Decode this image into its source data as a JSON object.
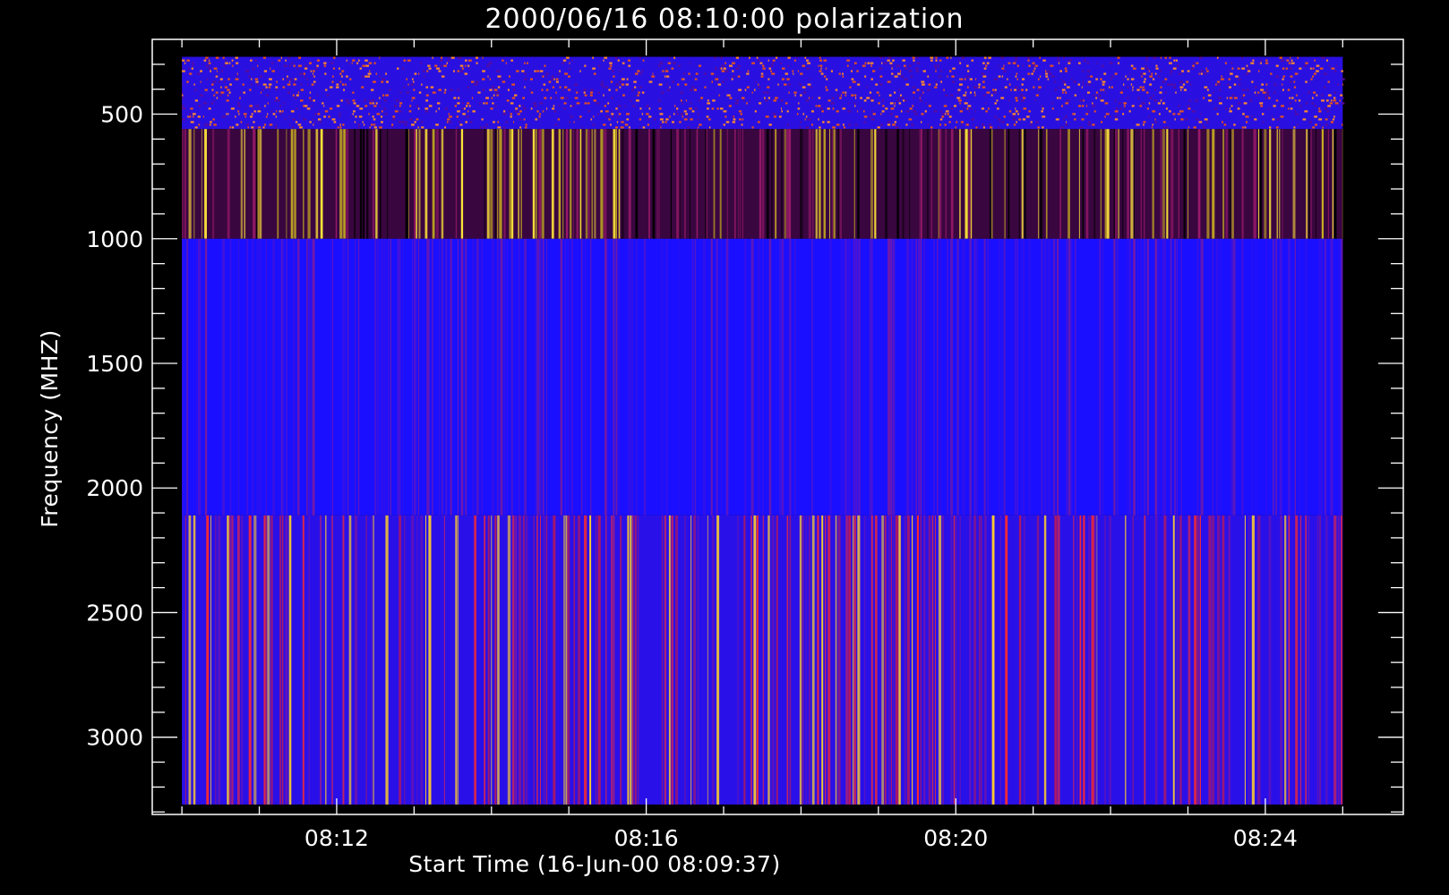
{
  "chart_data": {
    "type": "heatmap",
    "title": "2000/06/16 08:10:00 polarization",
    "xlabel": "Start Time (16-Jun-00 08:09:37)",
    "ylabel": "Frequency (MHZ)",
    "x_range": [
      "08:09:37",
      "08:25:47"
    ],
    "x_ticks": [
      "08:12",
      "08:16",
      "08:20",
      "08:24"
    ],
    "y_range": [
      200,
      3310
    ],
    "y_ticks": [
      500,
      1000,
      1500,
      2000,
      2500,
      3000
    ],
    "y_inverted": true,
    "data_x_range": [
      "08:10:00",
      "08:25:00"
    ],
    "data_y_range": [
      270,
      3270
    ],
    "bands": [
      {
        "from_mhz": 270,
        "to_mhz": 560,
        "pattern": "speckle",
        "base_color": "#2a10e0",
        "accent_colors": [
          "#ff8a2a",
          "#e8501a",
          "#5a0a9a"
        ]
      },
      {
        "from_mhz": 560,
        "to_mhz": 1000,
        "pattern": "vertical-stripes",
        "base_color": "#3a0640",
        "accent_colors": [
          "#ffe63a",
          "#c8b020",
          "#9a1a6a",
          "#000000"
        ]
      },
      {
        "from_mhz": 1000,
        "to_mhz": 2110,
        "pattern": "vertical-stripes",
        "base_color": "#1a10ff",
        "accent_colors": [
          "#5a14c8",
          "#3410e8",
          "#7a1aa0"
        ]
      },
      {
        "from_mhz": 2110,
        "to_mhz": 3270,
        "pattern": "vertical-stripes",
        "base_color": "#2a10e8",
        "accent_colors": [
          "#ff2a2a",
          "#b01860",
          "#6a14b0",
          "#ffd02a"
        ]
      }
    ],
    "grid": false,
    "legend": "none"
  }
}
